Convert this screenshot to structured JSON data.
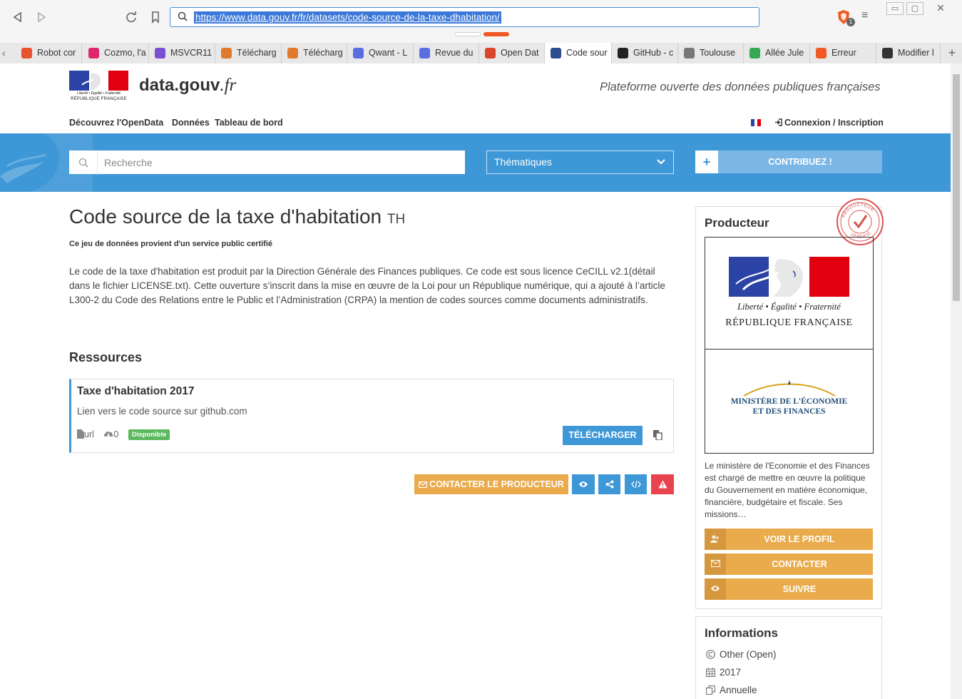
{
  "browser": {
    "url": "https://www.data.gouv.fr/fr/datasets/code-source-de-la-taxe-dhabitation/",
    "brave_badge": "1",
    "tabs": [
      {
        "label": "Robot cor",
        "color": "#e8522e",
        "active": false
      },
      {
        "label": "Cozmo, l'a",
        "color": "#e0256e",
        "active": false
      },
      {
        "label": "MSVCR11",
        "color": "#7b4fd1",
        "active": false
      },
      {
        "label": "Télécharg",
        "color": "#e07a2e",
        "active": false
      },
      {
        "label": "Télécharg",
        "color": "#e07a2e",
        "active": false
      },
      {
        "label": "Qwant - L",
        "color": "#5b6ee1",
        "active": false
      },
      {
        "label": "Revue du",
        "color": "#5b6ee1",
        "active": false
      },
      {
        "label": "Open Dat",
        "color": "#d9442a",
        "active": false
      },
      {
        "label": "Code sour",
        "color": "#2d4d8f",
        "active": true
      },
      {
        "label": "GitHub - c",
        "color": "#222222",
        "active": false
      },
      {
        "label": "Toulouse",
        "color": "#777777",
        "active": false
      },
      {
        "label": "Allée Jule",
        "color": "#34a853",
        "active": false
      },
      {
        "label": "Erreur",
        "color": "#f05a22",
        "active": false
      },
      {
        "label": "Modifier l",
        "color": "#333333",
        "active": false
      }
    ]
  },
  "site": {
    "logo_motto": "Liberté • Égalité • Fraternité",
    "logo_republic": "RÉPUBLIQUE FRANÇAISE",
    "name_main": "data.gouv",
    "name_ext": ".fr",
    "tagline": "Plateforme ouverte des données publiques françaises",
    "nav": [
      "Découvrez l'OpenData",
      "Données",
      "Tableau de bord"
    ],
    "login": "Connexion / Inscription",
    "search_placeholder": "Recherche",
    "themes_label": "Thématiques",
    "contribute_label": "CONTRIBUEZ !"
  },
  "dataset": {
    "title": "Code source de la taxe d'habitation",
    "acronym": "TH",
    "certified_text": "Ce jeu de données provient d'un service public certifié",
    "description": "Le code de la taxe d'habitation est produit par la Direction Générale des Finances publiques. Ce code est sous licence CeCILL v2.1(détail dans le fichier LICENSE.txt). Cette ouverture s’inscrit dans la mise en œuvre de la Loi pour un République numérique, qui a ajouté à l’article L300-2 du Code des Relations entre le Public et l’Administration (CRPA) la mention de codes sources comme documents administratifs.",
    "resources_heading": "Ressources",
    "resource": {
      "title": "Taxe d'habitation 2017",
      "description": "Lien vers le code source sur github.com",
      "format": "url",
      "downloads": "0",
      "status": "Disponible",
      "download_label": "TÉLÉCHARGER"
    },
    "contact_producer_label": "CONTACTER LE PRODUCTEUR"
  },
  "producer": {
    "heading": "Producteur",
    "seal_top": "PRODUCTEUR",
    "seal_bottom": "CERTIFIÉ",
    "logo_motto": "Liberté • Égalité • Fraternité",
    "logo_republic": "RÉPUBLIQUE FRANÇAISE",
    "ministry_line1": "MINISTÈRE DE L'ÉCONOMIE",
    "ministry_line2": "ET DES FINANCES",
    "description": "Le ministère de l'Economie et des Finances est chargé de mettre en œuvre la politique du Gouvernement en matière économique, financière, budgétaire et fiscale. Ses missions…",
    "profile_label": "VOIR LE PROFIL",
    "contact_label": "CONTACTER",
    "follow_label": "SUIVRE"
  },
  "informations": {
    "heading": "Informations",
    "license": "Other (Open)",
    "year": "2017",
    "frequency": "Annuelle"
  },
  "colors": {
    "brand_blue": "#3e97d6",
    "orange": "#e9ab4c",
    "red": "#e9434e",
    "green": "#5cb85c",
    "marianne_blue": "#2a43a5",
    "marianne_red": "#e1000f"
  }
}
